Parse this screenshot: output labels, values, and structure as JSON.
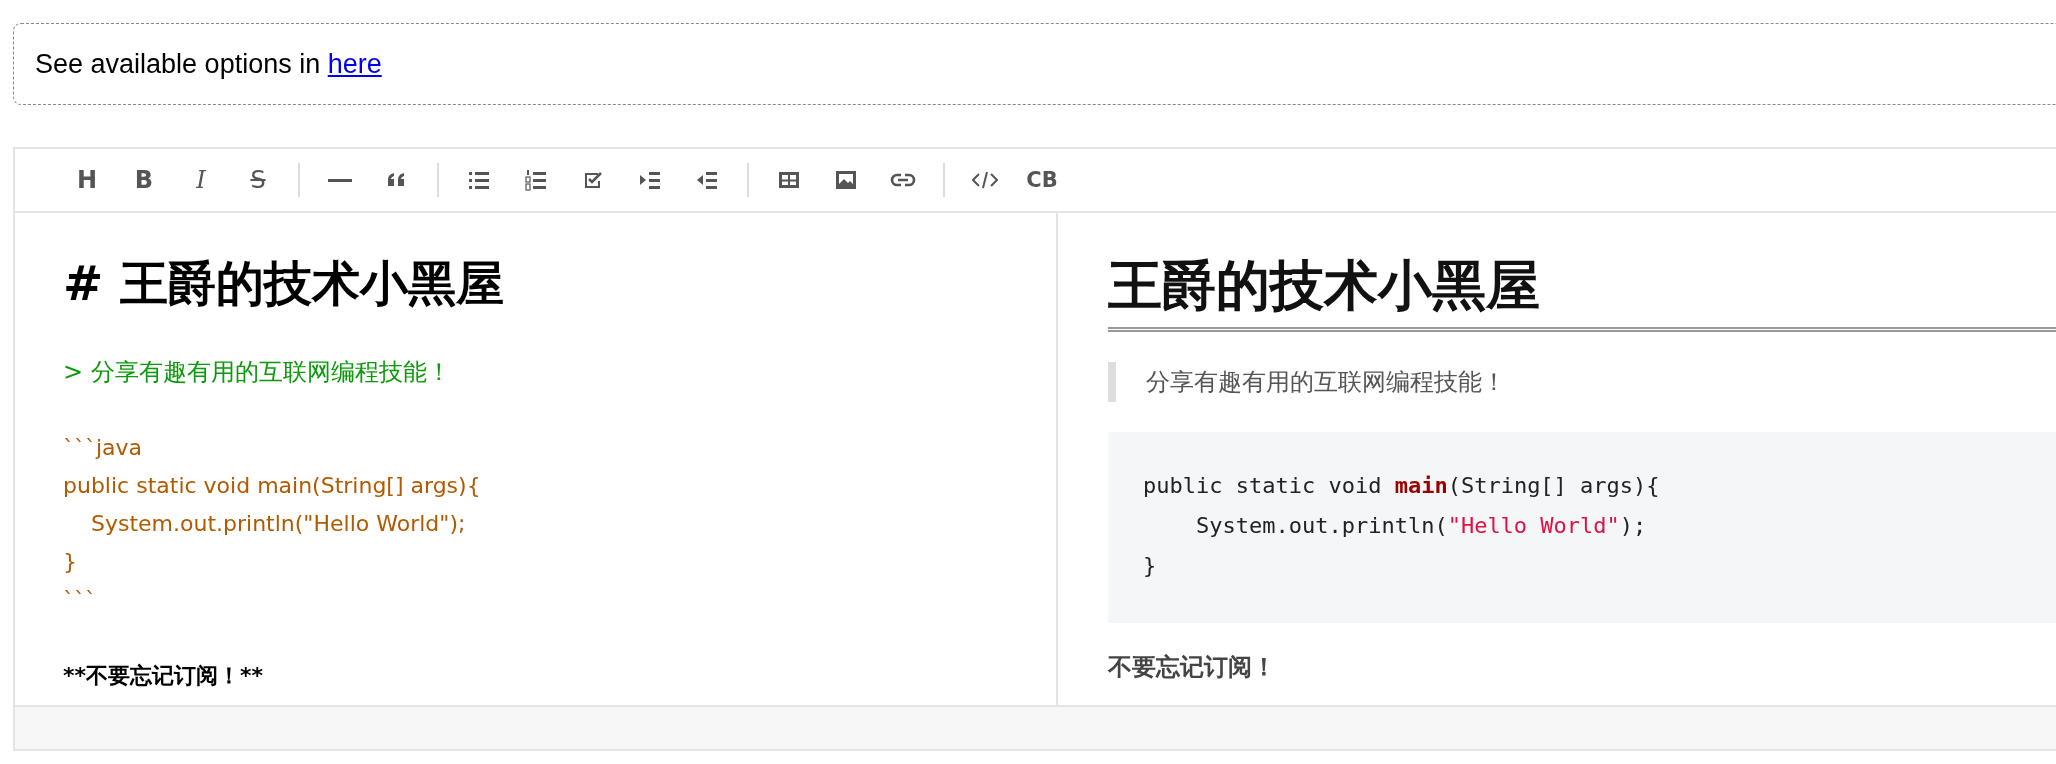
{
  "notice": {
    "text": "See available options in",
    "link": "here"
  },
  "toolbar_groups": [
    [
      {
        "kind": "heading",
        "label": "H"
      },
      {
        "kind": "bold",
        "label": "B"
      },
      {
        "kind": "italic",
        "label": "I"
      },
      {
        "kind": "strike",
        "label": "S"
      }
    ],
    [
      {
        "kind": "rule"
      },
      {
        "kind": "quote"
      }
    ],
    [
      {
        "kind": "bullet-list"
      },
      {
        "kind": "numbered-list"
      },
      {
        "kind": "task-list"
      },
      {
        "kind": "indent"
      },
      {
        "kind": "outdent"
      }
    ],
    [
      {
        "kind": "table"
      },
      {
        "kind": "image"
      },
      {
        "kind": "link"
      }
    ],
    [
      {
        "kind": "code"
      },
      {
        "kind": "code-block",
        "label": "CB"
      }
    ]
  ],
  "source_lines": [
    {
      "kind": "heading",
      "text": "# 王爵的技术小黑屋"
    },
    {
      "kind": "quote",
      "text": "> 分享有趣有用的互联网编程技能！"
    },
    {
      "kind": "code",
      "text": "```java"
    },
    {
      "kind": "code",
      "text": "public static void main(String[] args){"
    },
    {
      "kind": "code",
      "text": "    System.out.println(\"Hello World\");"
    },
    {
      "kind": "code",
      "text": "}"
    },
    {
      "kind": "code",
      "text": "```"
    },
    {
      "kind": "strong",
      "text": "**不要忘记订阅！**"
    }
  ],
  "preview": {
    "heading": "王爵的技术小黑屋",
    "blockquote": "分享有趣有用的互联网编程技能！",
    "code_lines": [
      [
        {
          "kind": "plain",
          "text": "public static void "
        },
        {
          "kind": "title",
          "text": "main"
        },
        {
          "kind": "plain",
          "text": "(String[] args){"
        }
      ],
      [
        {
          "kind": "plain",
          "text": "    System.out.println("
        },
        {
          "kind": "string",
          "text": "\"Hello World\""
        },
        {
          "kind": "plain",
          "text": ");"
        }
      ],
      [
        {
          "kind": "plain",
          "text": "}"
        }
      ]
    ],
    "paragraph": "不要忘记订阅！"
  }
}
